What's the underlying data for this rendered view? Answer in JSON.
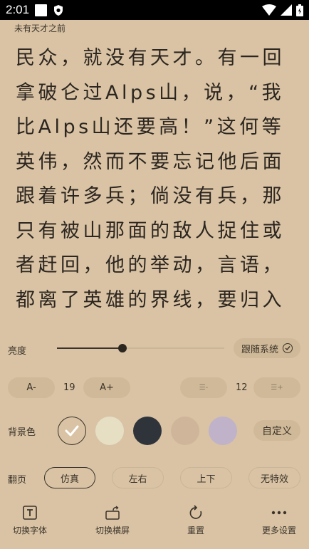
{
  "status_bar": {
    "time": "2:01"
  },
  "chapter": {
    "title": "未有天才之前"
  },
  "reading": {
    "lines": [
      "民众，就没有天才。有一回",
      "拿破仑过Alps山，说，“我",
      "比Alps山还要高！”这何等",
      "英伟，然而不要忘记他后面",
      "跟着许多兵；倘没有兵，那",
      "只有被山那面的敌人捉住或",
      "者赶回，他的举动，言语，",
      "都离了英雄的界线，要归入"
    ]
  },
  "settings": {
    "brightness": {
      "label": "亮度",
      "level_fraction": 0.39,
      "follow_system_label": "跟随系统"
    },
    "font_size": {
      "decrease_label": "A-",
      "value": "19",
      "increase_label": "A+"
    },
    "line_spacing": {
      "decrease_label": "☰-",
      "value": "12",
      "increase_label": "☰+"
    },
    "background": {
      "label": "背景色",
      "swatches": [
        {
          "name": "current",
          "color": "#d9c3a4",
          "selected": true
        },
        {
          "name": "cream",
          "color": "#e6dfc4"
        },
        {
          "name": "dark",
          "color": "#2f343b"
        },
        {
          "name": "tan",
          "color": "#cfb69b"
        },
        {
          "name": "lavender",
          "color": "#bfb2c9"
        }
      ],
      "custom_label": "自定义"
    },
    "page_flip": {
      "label": "翻页",
      "options": [
        "仿真",
        "左右",
        "上下",
        "无特效"
      ],
      "selected": "仿真"
    }
  },
  "bottom_bar": {
    "items": [
      {
        "label": "切换字体",
        "icon": "font-icon"
      },
      {
        "label": "切换横屏",
        "icon": "rotate-screen-icon"
      },
      {
        "label": "重置",
        "icon": "reset-icon"
      },
      {
        "label": "更多设置",
        "icon": "more-icon"
      }
    ]
  },
  "colors": {
    "background": "#d9c3a4",
    "pill": "#cfb998",
    "text": "#2c2620"
  }
}
